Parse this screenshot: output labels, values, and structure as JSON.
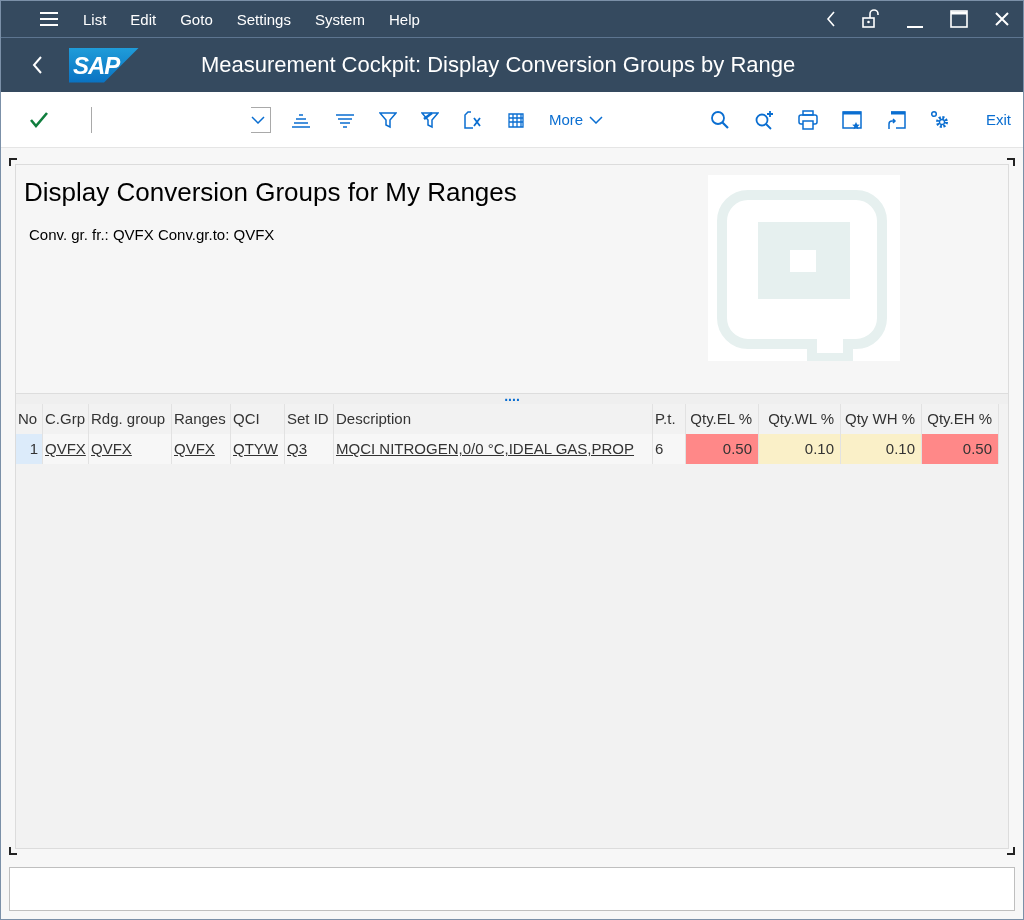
{
  "menu": [
    {
      "label": "List"
    },
    {
      "label": "Edit"
    },
    {
      "label": "Goto"
    },
    {
      "label": "Settings"
    },
    {
      "label": "System"
    },
    {
      "label": "Help"
    }
  ],
  "title_bar": {
    "logo": "SAP",
    "title": "Measurement Cockpit: Display Conversion Groups by Range"
  },
  "toolbar": {
    "more": "More",
    "exit": "Exit"
  },
  "header": {
    "title": "Display Conversion Groups for My Ranges",
    "subtitle": "Conv. gr. fr.: QVFX Conv.gr.to: QVFX",
    "splitter": "...."
  },
  "table": {
    "columns": [
      {
        "label": "No"
      },
      {
        "label": "C.Grp"
      },
      {
        "label": "Rdg. group"
      },
      {
        "label": "Ranges"
      },
      {
        "label": "QCI"
      },
      {
        "label": "Set ID"
      },
      {
        "label": "Description"
      },
      {
        "label": "P.t."
      },
      {
        "label": "Qty.EL %"
      },
      {
        "label": "Qty.WL %"
      },
      {
        "label": "Qty WH %"
      },
      {
        "label": "Qty.EH %"
      }
    ],
    "rows": [
      {
        "cells": [
          {
            "text": "1",
            "kind": "index"
          },
          {
            "text": "QVFX",
            "kind": "link"
          },
          {
            "text": "QVFX",
            "kind": "link"
          },
          {
            "text": "QVFX",
            "kind": "link"
          },
          {
            "text": "QTYW",
            "kind": "link"
          },
          {
            "text": "Q3",
            "kind": "link"
          },
          {
            "text": "MQCI NITROGEN,0/0 °C,IDEAL GAS,PROP",
            "kind": "link"
          },
          {
            "text": "6",
            "kind": "text"
          },
          {
            "text": "0.50",
            "kind": "number",
            "color": "#ff8888"
          },
          {
            "text": "0.10",
            "kind": "number",
            "color": "#faf0c8"
          },
          {
            "text": "0.10",
            "kind": "number",
            "color": "#faf0c8"
          },
          {
            "text": "0.50",
            "kind": "number",
            "color": "#ff8888"
          }
        ]
      }
    ]
  }
}
